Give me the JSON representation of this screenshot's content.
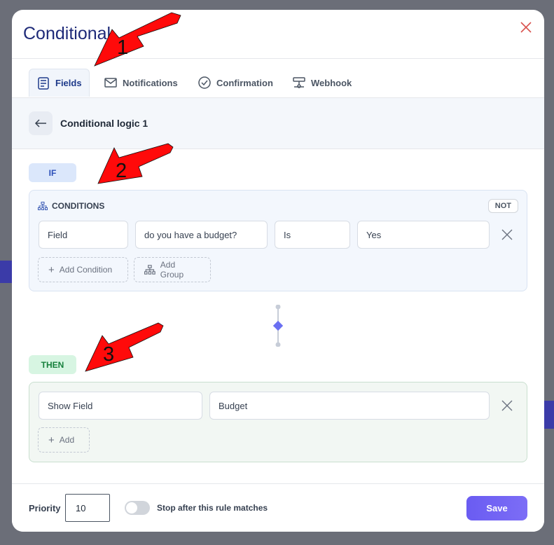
{
  "modal": {
    "title": "Conditional"
  },
  "tabs": [
    {
      "label": "Fields",
      "icon": "form-icon",
      "active": true
    },
    {
      "label": "Notifications",
      "icon": "envelope-icon",
      "active": false
    },
    {
      "label": "Confirmation",
      "icon": "check-circle-icon",
      "active": false
    },
    {
      "label": "Webhook",
      "icon": "webhook-icon",
      "active": false
    }
  ],
  "subheader": {
    "title": "Conditional logic 1"
  },
  "if_block": {
    "pill": "IF",
    "conditions_label": "CONDITIONS",
    "not_label": "NOT",
    "condition": {
      "subject": "Field",
      "field": "do you have a budget?",
      "operator": "Is",
      "value": "Yes"
    },
    "add_condition_label": "Add Condition",
    "add_group_label": "Add Group"
  },
  "then_block": {
    "pill": "THEN",
    "action": {
      "type": "Show Field",
      "target": "Budget"
    },
    "add_label": "Add"
  },
  "footer": {
    "priority_label": "Priority",
    "priority_value": "10",
    "stop_label": "Stop after this rule matches",
    "stop_enabled": false,
    "save_label": "Save"
  },
  "annotations": [
    "1",
    "2",
    "3"
  ],
  "colors": {
    "accent": "#6a5cf2",
    "title": "#1e2a78",
    "arrow": "#ff0000",
    "if_bg": "#dbe7fb",
    "then_bg": "#d7f5e2"
  }
}
